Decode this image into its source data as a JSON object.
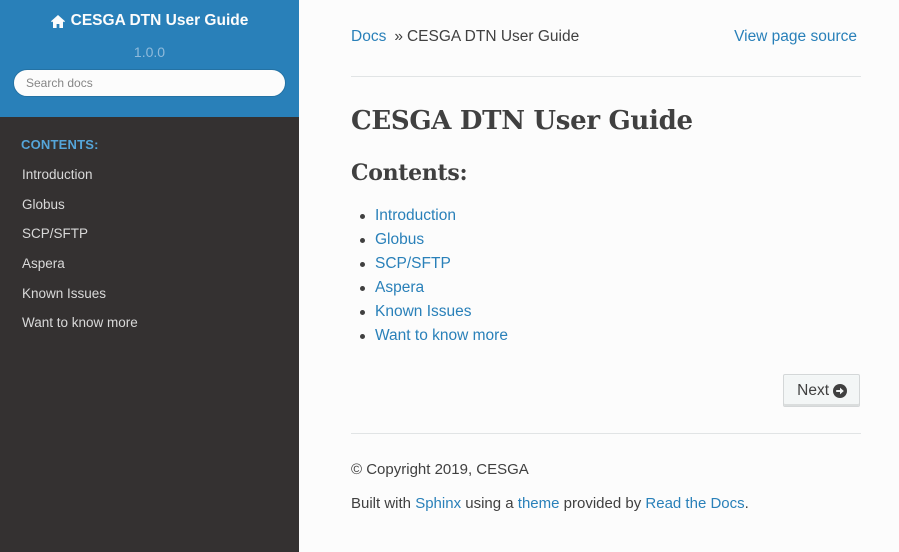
{
  "sidebar": {
    "project_title": "CESGA DTN User Guide",
    "home_icon": "home-icon",
    "version": "1.0.0",
    "search_placeholder": "Search docs",
    "caption": "CONTENTS:",
    "items": [
      {
        "label": "Introduction"
      },
      {
        "label": "Globus"
      },
      {
        "label": "SCP/SFTP"
      },
      {
        "label": "Aspera"
      },
      {
        "label": "Known Issues"
      },
      {
        "label": "Want to know more"
      }
    ]
  },
  "breadcrumbs": {
    "docs_link": "Docs",
    "separator": "»",
    "current": "CESGA DTN User Guide",
    "view_source": "View page source"
  },
  "main": {
    "title": "CESGA DTN User Guide",
    "contents_heading": "Contents:",
    "toc": [
      {
        "label": "Introduction"
      },
      {
        "label": "Globus"
      },
      {
        "label": "SCP/SFTP"
      },
      {
        "label": "Aspera"
      },
      {
        "label": "Known Issues"
      },
      {
        "label": "Want to know more"
      }
    ],
    "next_label": "Next",
    "next_icon": "arrow-circle-right-icon"
  },
  "footer": {
    "copyright": "© Copyright 2019, CESGA",
    "built_prefix": "Built with",
    "sphinx_link": "Sphinx",
    "built_middle": "using a",
    "theme_link": "theme",
    "built_provided": "provided by",
    "rtd_link": "Read the Docs",
    "built_suffix": "."
  },
  "colors": {
    "accent": "#2980b9",
    "sidebar_bg": "#343131",
    "text": "#404040",
    "caption": "#55a5d9"
  }
}
